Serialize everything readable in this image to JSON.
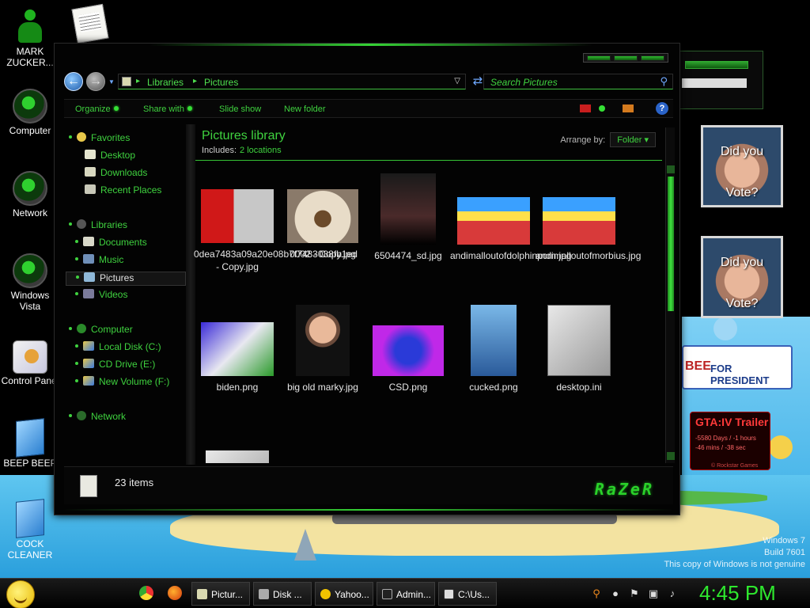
{
  "desktop": {
    "icons": [
      {
        "label": "MARK ZUCKER..."
      },
      {
        "label": "Computer"
      },
      {
        "label": "Network"
      },
      {
        "label": "Windows Vista"
      },
      {
        "label": "Control Panel"
      },
      {
        "label": "BEEP BEEP"
      },
      {
        "label": "COCK CLEANER"
      }
    ],
    "watermark": [
      "Windows 7",
      "Build 7601",
      "This copy of Windows is not genuine"
    ]
  },
  "gadgets": {
    "vote1": {
      "line1": "Did you",
      "line2": "Vote?"
    },
    "vote2": {
      "line1": "Did you",
      "line2": "Vote?"
    },
    "bee_banner": {
      "left": "BEE",
      "right": "FOR PRESIDENT"
    },
    "gta": {
      "title": "GTA:IV Trailer",
      "line1": "-5580 Days / -1 hours",
      "line2": "-46 mins / -38 sec",
      "brand": "© Rockstar Games"
    }
  },
  "explorer": {
    "address": {
      "crumbs": [
        "Libraries",
        "Pictures"
      ]
    },
    "search": {
      "placeholder": "Search Pictures"
    },
    "toolbar": [
      "Organize",
      "Share with",
      "Slide show",
      "New folder"
    ],
    "nav": {
      "favorites": {
        "label": "Favorites",
        "items": [
          "Desktop",
          "Downloads",
          "Recent Places"
        ]
      },
      "libraries": {
        "label": "Libraries",
        "items": [
          "Documents",
          "Music",
          "Pictures",
          "Videos"
        ]
      },
      "computer": {
        "label": "Computer",
        "items": [
          "Local Disk (C:)",
          "CD Drive (E:)",
          "New Volume (F:)"
        ]
      },
      "network": {
        "label": "Network"
      }
    },
    "library": {
      "title": "Pictures library",
      "includes_label": "Includes:",
      "includes_link": "2 locations",
      "arrange_label": "Arrange by:",
      "arrange_value": "Folder"
    },
    "files": [
      "0dea7483a09a20e08b7f7483088fb1ed - Copy.jpg",
      "0002 - Copy.jpg",
      "6504474_sd.jpg",
      "andimalloutofdolphinporn.jpg",
      "andimalloutofmorbius.jpg",
      "biden.png",
      "big old marky.jpg",
      "CSD.png",
      "cucked.png",
      "desktop.ini"
    ],
    "status": {
      "count": "23 items",
      "brand": "RaZeR"
    }
  },
  "taskbar": {
    "tasks": [
      "Pictur...",
      "Disk ...",
      "Yahoo...",
      "Admin...",
      "C:\\Us..."
    ],
    "clock": "4:45 PM"
  }
}
